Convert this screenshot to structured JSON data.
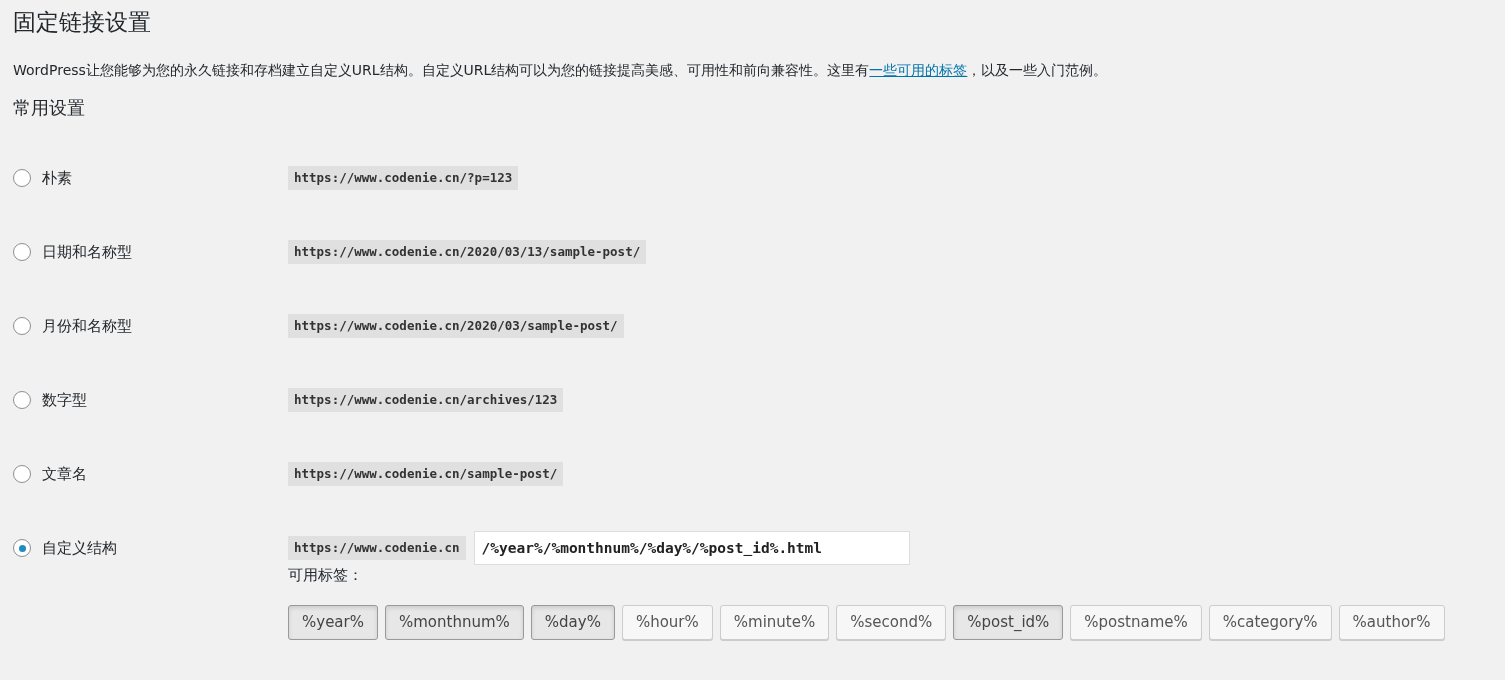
{
  "title": "固定链接设置",
  "description": {
    "before": "WordPress让您能够为您的永久链接和存档建立自定义URL结构。自定义URL结构可以为您的链接提高美感、可用性和前向兼容性。这里有",
    "link": "一些可用的标签",
    "after": "，以及一些入门范例。"
  },
  "section_title": "常用设置",
  "options": [
    {
      "label": "朴素",
      "selected": false,
      "example": "https://www.codenie.cn/?p=123"
    },
    {
      "label": "日期和名称型",
      "selected": false,
      "example": "https://www.codenie.cn/2020/03/13/sample-post/"
    },
    {
      "label": "月份和名称型",
      "selected": false,
      "example": "https://www.codenie.cn/2020/03/sample-post/"
    },
    {
      "label": "数字型",
      "selected": false,
      "example": "https://www.codenie.cn/archives/123"
    },
    {
      "label": "文章名",
      "selected": false,
      "example": "https://www.codenie.cn/sample-post/"
    },
    {
      "label": "自定义结构",
      "selected": true,
      "example": "https://www.codenie.cn",
      "value": "/%year%/%monthnum%/%day%/%post_id%.html"
    }
  ],
  "tags_label": "可用标签：",
  "tags": [
    {
      "label": "%year%",
      "selected": true
    },
    {
      "label": "%monthnum%",
      "selected": true
    },
    {
      "label": "%day%",
      "selected": true
    },
    {
      "label": "%hour%",
      "selected": false
    },
    {
      "label": "%minute%",
      "selected": false
    },
    {
      "label": "%second%",
      "selected": false
    },
    {
      "label": "%post_id%",
      "selected": true
    },
    {
      "label": "%postname%",
      "selected": false
    },
    {
      "label": "%category%",
      "selected": false
    },
    {
      "label": "%author%",
      "selected": false
    }
  ]
}
